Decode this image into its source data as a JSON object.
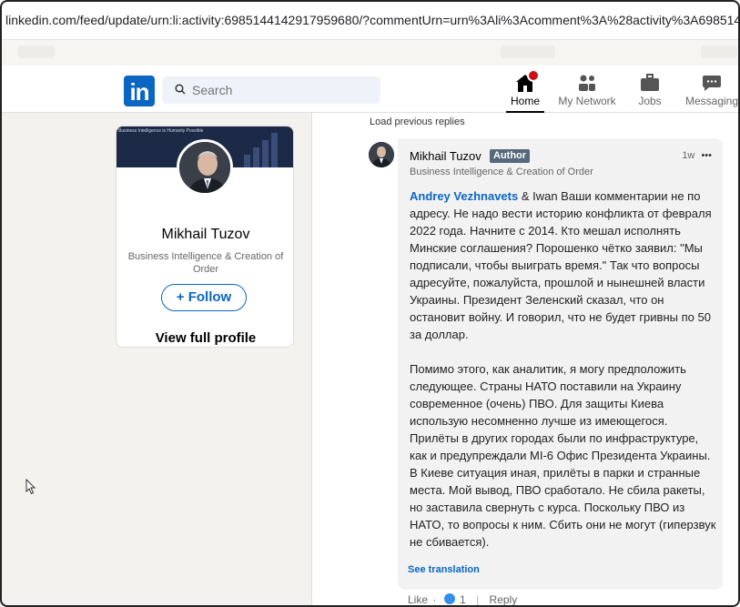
{
  "browser": {
    "url": "linkedin.com/feed/update/urn:li:activity:6985144142917959680/?commentUrn=urn%3Ali%3Acomment%3A%28activity%3A69851441"
  },
  "nav": {
    "search_placeholder": "Search",
    "items": [
      {
        "label": "Home",
        "icon": "home-icon"
      },
      {
        "label": "My Network",
        "icon": "network-icon"
      },
      {
        "label": "Jobs",
        "icon": "briefcase-icon"
      },
      {
        "label": "Messaging",
        "icon": "messaging-icon"
      }
    ],
    "accent_color": "#0a66c2"
  },
  "profile_card": {
    "banner_text": "Business Intelligence is Humanly Possible",
    "name": "Mikhail Tuzov",
    "headline": "Business Intelligence & Creation of Order",
    "follow_label": "+ Follow",
    "view_profile_label": "View full profile"
  },
  "comments": {
    "load_previous": "Load previous replies",
    "comment": {
      "author": "Mikhail Tuzov",
      "badge": "Author",
      "time": "1w",
      "more": "•••",
      "headline": "Business Intelligence & Creation of Order",
      "mention": "Andrey Vezhnavets",
      "text": " & Iwan Ваши комментарии не по адресу. Не надо вести историю конфликта от февраля 2022 года. Начните с 2014. Кто мешал исполнять Минские соглашения? Порошенко чётко заявил: \"Мы подписали, чтобы выиграть время.\" Так что вопросы адресуйте, пожалуйста, прошлой и нынешней власти Украины. Президент Зеленский сказал, что он остановит войну. И говорил, что не будет гривны по 50 за доллар.\n\nПомимо этого, как аналитик, я могу предположить следующее. Страны НАТО поставили на Украину современное (очень) ПВО. Для защиты Киева использую несомненно лучше из имеющегося. Прилёты в других городах были по инфраструктуре, как и предупреждали MI-6 Офис Президента Украины. В Киеве ситуация иная, прилёты в парки и странные места. Мой вывод, ПВО сработало. Не сбила ракеты, но заставила свернуть с курса. Поскольку ПВО из НАТО, то вопросы к ним. Сбить они не могут (гиперзвук не сбивается).",
      "see_translation": "See translation",
      "like_label": "Like",
      "separator": "·",
      "like_count": "1",
      "pipe": "|",
      "reply_label": "Reply"
    }
  }
}
